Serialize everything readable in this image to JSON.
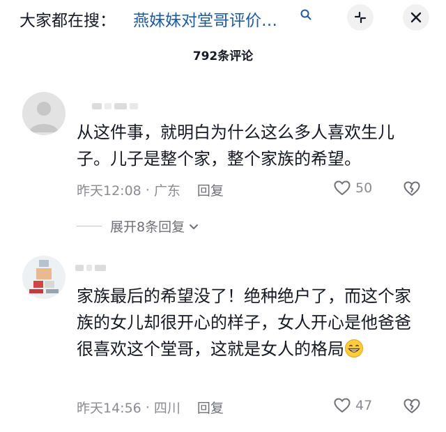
{
  "header": {
    "search_prefix": "大家都在搜：",
    "search_query": "燕妹妹对堂哥评价…",
    "comment_count": "792条评论"
  },
  "comments": [
    {
      "text": "从这件事，就明白为什么这么多人喜欢生儿子。儿子是整个家，整个家族的希望。",
      "time": "昨天12:08",
      "separator": "·",
      "location": "广东",
      "reply_label": "回复",
      "likes": "50",
      "expand_label": "展开8条回复"
    },
    {
      "text": "家族最后的希望没了！绝种绝户了，而这个家族的女儿却很开心的样子，女人开心是他爸爸很喜欢这个堂哥，这就是女人的格局",
      "time": "昨天14:56",
      "separator": "·",
      "location": "四川",
      "reply_label": "回复",
      "likes": "47"
    }
  ],
  "colors": {
    "query_link": "#1d5a9e",
    "meta_gray": "#8a8b91",
    "text": "#161823"
  },
  "icons": [
    "search-icon",
    "minimize-icon",
    "close-icon",
    "heart-icon",
    "broken-heart-icon",
    "chevron-down-icon",
    "grin-emoji-icon"
  ]
}
